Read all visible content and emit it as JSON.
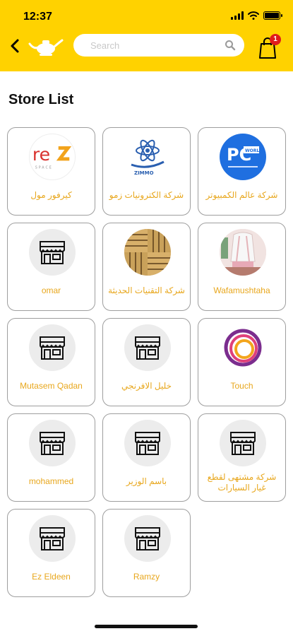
{
  "status_bar": {
    "time": "12:37"
  },
  "header": {
    "search": {
      "placeholder": "Search",
      "value": ""
    },
    "cart_count": "1",
    "accent_color": "#ffd200",
    "badge_color": "#e01b1b",
    "icons": [
      "back-arrow-icon",
      "logo-icon",
      "search-icon",
      "shopping-bag-icon"
    ]
  },
  "page": {
    "title": "Store List",
    "name_color": "#e8a71d",
    "stores": [
      {
        "name": "كيرفور مول",
        "icon": "rez-logo-icon"
      },
      {
        "name": "شركة الكترونيات زمو",
        "icon": "zimmo-logo-icon"
      },
      {
        "name": "شركة عالم الكمبيوتر",
        "icon": "pc-world-logo-icon"
      },
      {
        "name": "omar",
        "icon": "store-icon"
      },
      {
        "name": "شركة التقنيات الحديثة",
        "icon": "parquet-pattern-icon"
      },
      {
        "name": "Wafamushtaha",
        "icon": "room-photo-icon"
      },
      {
        "name": "Mutasem Qadan",
        "icon": "store-icon"
      },
      {
        "name": "خليل الافرنجي",
        "icon": "store-icon"
      },
      {
        "name": "Touch",
        "icon": "touch-rings-logo-icon"
      },
      {
        "name": "mohammed",
        "icon": "store-icon"
      },
      {
        "name": "باسم الوزير",
        "icon": "store-icon"
      },
      {
        "name": "شركة مشتهى لقطع غيار السيارات",
        "icon": "store-icon"
      },
      {
        "name": "Ez Eldeen",
        "icon": "store-icon"
      },
      {
        "name": "Ramzy",
        "icon": "store-icon"
      }
    ]
  }
}
